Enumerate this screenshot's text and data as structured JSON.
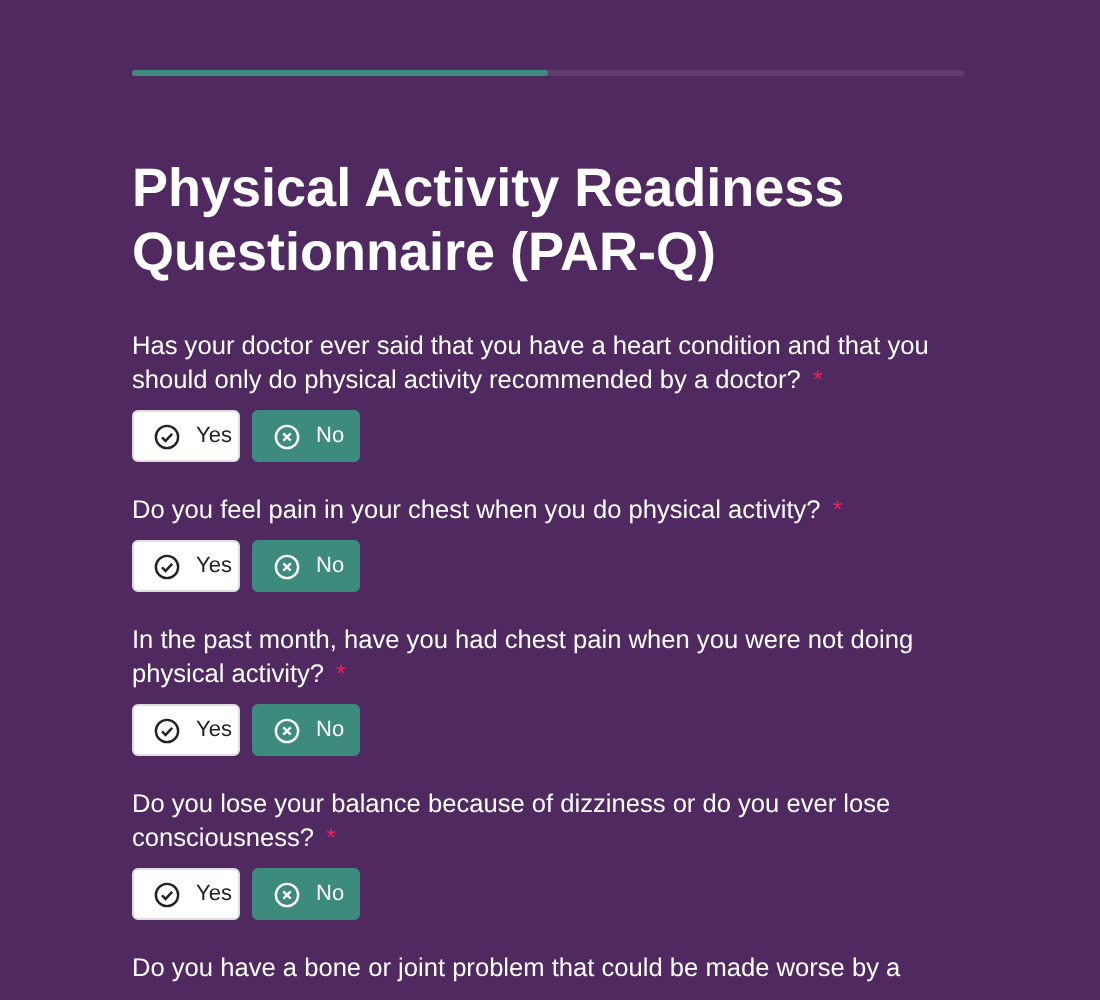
{
  "progress": {
    "level": 0.5
  },
  "title": "Physical Activity Readiness Questionnaire (PAR-Q)",
  "questions": [
    {
      "text": "Has your doctor ever said that you have a heart condition and that you should only do physical activity recommended by a doctor?",
      "required_mark": "*",
      "options": [
        {
          "label": "Yes",
          "kind": "yes",
          "selected": false
        },
        {
          "label": "No",
          "kind": "no",
          "selected": true
        }
      ]
    },
    {
      "text": "Do you feel pain in your chest when you do physical activity?",
      "required_mark": "*",
      "options": [
        {
          "label": "Yes",
          "kind": "yes",
          "selected": false
        },
        {
          "label": "No",
          "kind": "no",
          "selected": true
        }
      ]
    },
    {
      "text": "In the past month, have you had chest pain when you were not doing physical activity?",
      "required_mark": "*",
      "options": [
        {
          "label": "Yes",
          "kind": "yes",
          "selected": false
        },
        {
          "label": "No",
          "kind": "no",
          "selected": true
        }
      ]
    },
    {
      "text": "Do you lose your balance because of dizziness or do you ever lose consciousness?",
      "required_mark": "*",
      "options": [
        {
          "label": "Yes",
          "kind": "yes",
          "selected": false
        },
        {
          "label": "No",
          "kind": "no",
          "selected": true
        }
      ]
    },
    {
      "text": "Do you have a bone or joint problem that could be made worse by a"
    }
  ]
}
